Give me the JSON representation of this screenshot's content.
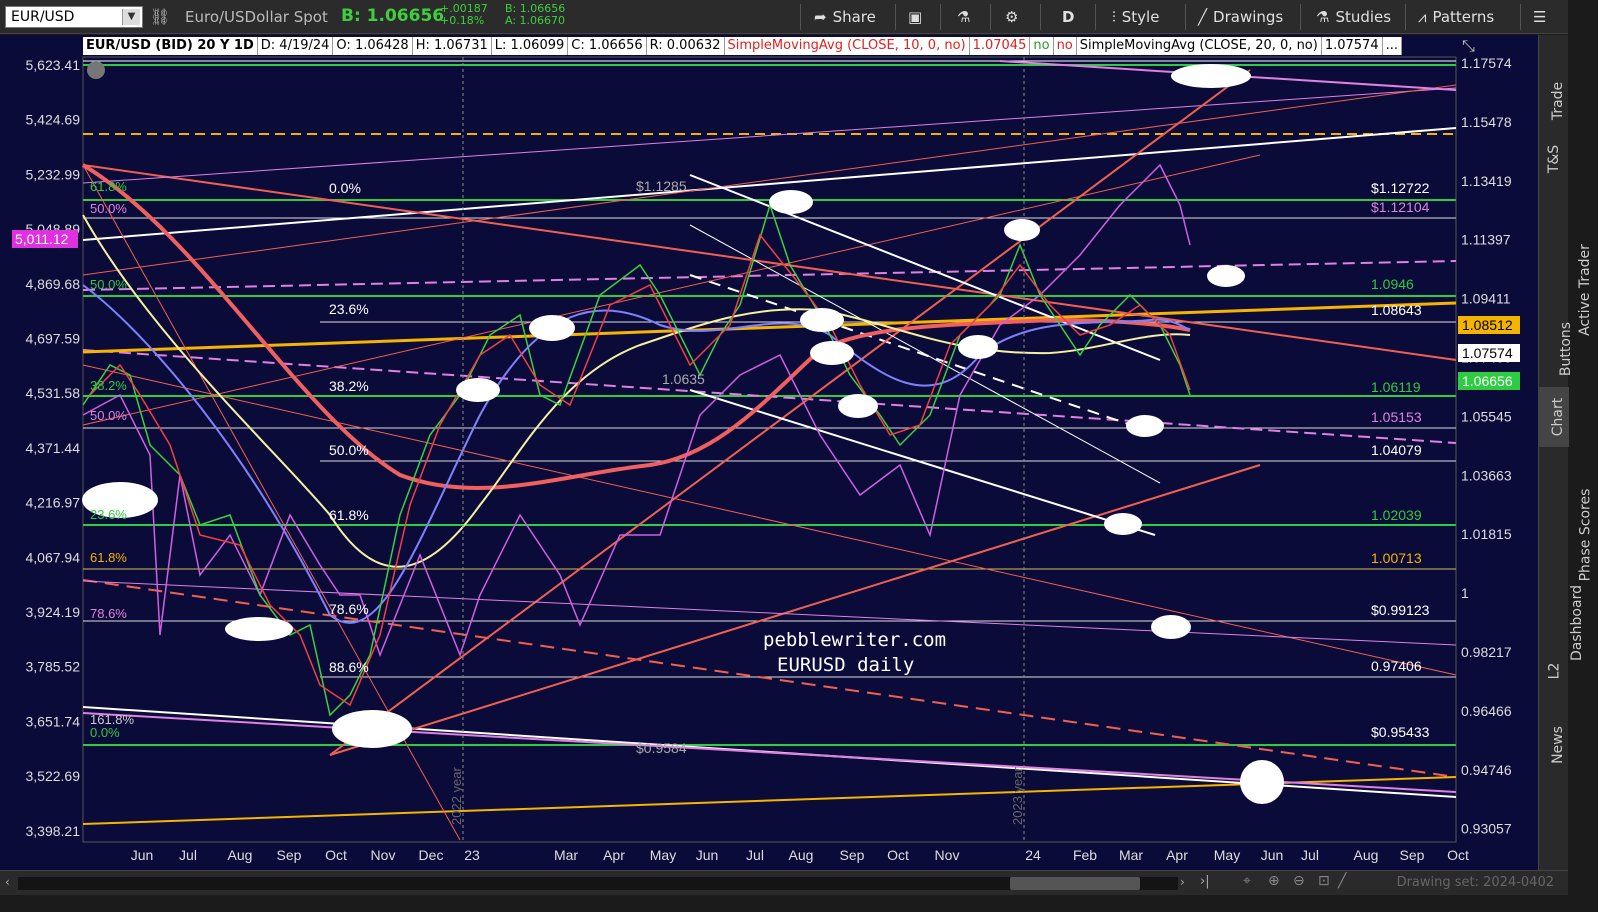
{
  "toolbar": {
    "symbol": "EUR/USD",
    "description": "Euro/USDollar Spot",
    "bid": "B: 1.06656",
    "change_abs": "+.00187",
    "change_pct": "+0.18%",
    "bid_small": "B: 1.06656",
    "ask_small": "A: 1.06670",
    "share": "Share",
    "period": "D",
    "style": "Style",
    "drawings": "Drawings",
    "studies": "Studies",
    "patterns": "Patterns"
  },
  "legend": {
    "title": "EUR/USD (BID) 20 Y 1D",
    "date": "D: 4/19/24",
    "open": "O: 1.06428",
    "high": "H: 1.06731",
    "low": "L: 1.06099",
    "close": "C: 1.06656",
    "range": "R: 0.00632",
    "sma10": "SimpleMovingAvg (CLOSE, 10, 0, no)",
    "sma10_val": "1.07045",
    "no1": "no",
    "no2": "no",
    "sma20": "SimpleMovingAvg (CLOSE, 20, 0, no)",
    "sma20_val": "1.07574",
    "more": "..."
  },
  "left_axis": [
    "5,623.41",
    "5,424.69",
    "5,232.99",
    "5,048.89",
    "4,869.68",
    "4,697.59",
    "4,531.58",
    "4,371.44",
    "4,216.97",
    "4,067.94",
    "3,924.19",
    "3,785.52",
    "3,651.74",
    "3,522.69",
    "3,398.21"
  ],
  "left_badge": "5,011.12",
  "right_axis": [
    "1.17574",
    "1.15478",
    "1.13419",
    "1.11397",
    "1.09411",
    "1.07460",
    "1.05545",
    "1.03663",
    "1.01815",
    "1",
    "0.98217",
    "0.96466",
    "0.94746",
    "0.93057"
  ],
  "right_badges": {
    "sma10": "1.08512",
    "sma20": "1.07574",
    "last": "1.06656"
  },
  "x_axis": [
    "Jun",
    "Jul",
    "Aug",
    "Sep",
    "Oct",
    "Nov",
    "Dec",
    "23",
    "Mar",
    "Apr",
    "May",
    "Jun",
    "Jul",
    "Aug",
    "Sep",
    "Oct",
    "Nov",
    "24",
    "Feb",
    "Mar",
    "Apr",
    "May",
    "Jun",
    "Jul",
    "Aug",
    "Sep",
    "Oct"
  ],
  "fib_left": [
    "61.8%",
    "50.0%",
    "50.0%",
    "38.2%",
    "50.0%",
    "23.6%",
    "61.8%",
    "78.6%",
    "161.8%",
    "0.0%"
  ],
  "fib_mid": [
    "0.0%",
    "23.6%",
    "38.2%",
    "50.0%",
    "61.8%",
    "78.6%",
    "88.6%"
  ],
  "price_labels_right": [
    "$1.12722",
    "$1.12104",
    "1.0946",
    "1.08643",
    "1.06119",
    "1.05153",
    "1.04079",
    "1.02039",
    "1.00713",
    "$0.99123",
    "0.97406",
    "$0.95433"
  ],
  "mid_prices": [
    "$1.1285",
    "1.0635",
    "$0.9584"
  ],
  "watermark": [
    "pebblewriter.com",
    "EURUSD daily"
  ],
  "year_labels": [
    "2022 year",
    "2023 year"
  ],
  "side_tabs": [
    "Trade",
    "T&S",
    "Active Trader",
    "Buttons",
    "Chart",
    "Phase Scores",
    "Dashboard",
    "L2",
    "News"
  ],
  "drawing_set": "Drawing set: 2024-0402"
}
